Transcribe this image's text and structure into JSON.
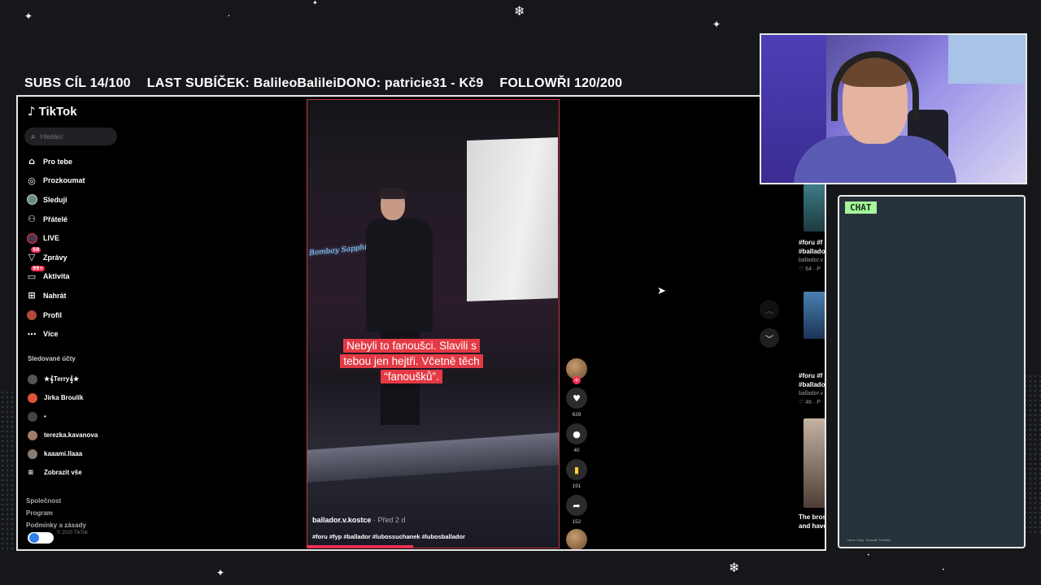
{
  "stream": {
    "subs_goal": "SUBS CÍL 14/100",
    "last_sub": "LAST SUBÍČEK: BalileoBalileiDONO: patricie31 - Kč9",
    "followers_goal": "FOLLOWŘI 120/200",
    "chat_label": "CHAT",
    "chat_note": "Ivene Chey: Ill jacate Tlelelais"
  },
  "tiktok": {
    "logo": "TikTok",
    "search_placeholder": "Hledání",
    "nav": [
      {
        "label": "Pro tebe",
        "icon": "home-icon"
      },
      {
        "label": "Prozkoumat",
        "icon": "compass-icon"
      },
      {
        "label": "Sleduji",
        "icon": "following-avatar-icon"
      },
      {
        "label": "Přátelé",
        "icon": "friends-icon"
      },
      {
        "label": "LIVE",
        "icon": "live-icon"
      },
      {
        "label": "Zprávy",
        "icon": "messages-icon",
        "badge": "58"
      },
      {
        "label": "Aktivita",
        "icon": "activity-icon",
        "badge": "99+"
      },
      {
        "label": "Nahrát",
        "icon": "upload-icon"
      },
      {
        "label": "Profil",
        "icon": "profile-icon"
      },
      {
        "label": "Více",
        "icon": "more-icon"
      }
    ],
    "followed_title": "Sledované účty",
    "followed": [
      {
        "name": "★𝄞Terry𝄞★",
        "color": "#555555"
      },
      {
        "name": "Jirka Broulík",
        "color": "#e0533a"
      },
      {
        "name": "▪",
        "color": "#444444"
      },
      {
        "name": "terezka.kavanova",
        "color": "#a27a6a"
      },
      {
        "name": "kaaami.llaaa",
        "color": "#8a7a70"
      }
    ],
    "show_all": "Zobrazit vše",
    "footer": [
      "Společnost",
      "Program",
      "Podmínky a zásady"
    ],
    "footer_small": "© 2025 TikTok"
  },
  "video": {
    "caption": "Nebyli to fanoušci. Slavili s tebou jen hejtři. Včetně těch “fanoušků”.",
    "neon_sign": "Bombay Sapphire",
    "author": "ballador.v.kostce",
    "time": " · Před 2 d",
    "hashtags": "#foru #fyp #ballador #lubossuchanek #lubosballador",
    "progress": 0.42,
    "likes": "639",
    "comments": "40",
    "saves": "191",
    "shares": "152"
  },
  "right_feed": [
    {
      "title": "#foru #f",
      "line2": "#ballado",
      "author": "ballador.v",
      "likes": "♡ 64 · P"
    },
    {
      "title": "#foru #f",
      "line2": "#ballado",
      "author": "ballador.v",
      "likes": "♡ 46 · P"
    },
    {
      "title": "The bros",
      "line2": "and have",
      "author": "",
      "likes": ""
    }
  ],
  "colors": {
    "accent": "#fe2c55",
    "chat_label_bg": "#a6f59a",
    "chat_bg": "#27323a"
  }
}
